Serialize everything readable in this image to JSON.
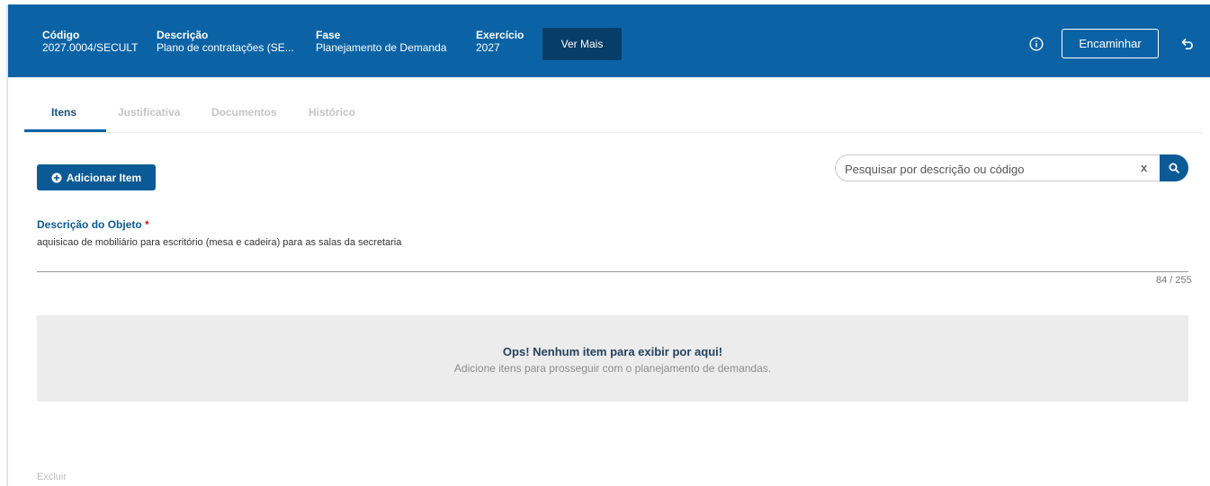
{
  "header": {
    "codigo_label": "Código",
    "codigo_value": "2027.0004/SECULT",
    "descricao_label": "Descrição",
    "descricao_value": "Plano de contratações (SE...",
    "fase_label": "Fase",
    "fase_value": "Planejamento de Demanda",
    "exercicio_label": "Exercício",
    "exercicio_value": "2027",
    "ver_mais_label": "Ver Mais",
    "encaminhar_label": "Encaminhar",
    "info_icon": "info-circle-icon",
    "back_icon": "undo-arrow-icon"
  },
  "tabs": [
    {
      "label": "Itens",
      "active": true
    },
    {
      "label": "Justificativa",
      "active": false
    },
    {
      "label": "Documentos",
      "active": false
    },
    {
      "label": "Histórico",
      "active": false
    }
  ],
  "toolbar": {
    "add_item_label": "Adicionar Item",
    "search_placeholder": "Pesquisar por descrição ou código",
    "clear_label": "x"
  },
  "objeto": {
    "label": "Descrição do Objeto",
    "required_mark": "*",
    "value": "aquisicao de mobiliário para escritório (mesa e cadeira) para as salas da secretaria",
    "char_count": "84 / 255"
  },
  "empty_state": {
    "title": "Ops! Nenhum item para exibir por aqui!",
    "text": "Adicione itens para prosseguir com o planejamento de demandas."
  },
  "footer": {
    "excluir_label": "Excluir"
  },
  "colors": {
    "primary": "#0b63a6",
    "primary_dark": "#073e69",
    "required": "#d01e1e",
    "empty_bg": "#ececec"
  }
}
